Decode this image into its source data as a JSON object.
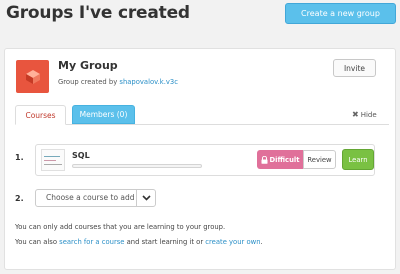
{
  "header": {
    "title": "Groups I've created",
    "create_button": "Create a new group"
  },
  "group": {
    "name": "My Group",
    "created_by_prefix": "Group created by ",
    "creator": "shapovalov.k.v3c",
    "invite_button": "Invite",
    "logo_color": "#e8553e"
  },
  "tabs": {
    "courses": "Courses",
    "members": "Members (0)",
    "hide": "Hide"
  },
  "courses": [
    {
      "number": "1.",
      "name": "SQL",
      "progress": 0,
      "difficult_label": "Difficult",
      "review_label": "Review",
      "learn_label": "Learn"
    }
  ],
  "add_course": {
    "number": "2.",
    "select_value": "Choose a course to add"
  },
  "info": {
    "line1": "You can only add courses that you are learning to your group.",
    "line2_prefix": "You can also ",
    "line2_link1": "search for a course",
    "line2_middle": " and start learning it or ",
    "line2_link2": "create your own",
    "line2_suffix": "."
  },
  "colors": {
    "accent_blue": "#5bc0eb",
    "difficult_pink": "#e0709a",
    "learn_green": "#7ac143",
    "link_blue": "#2a8fc7"
  }
}
